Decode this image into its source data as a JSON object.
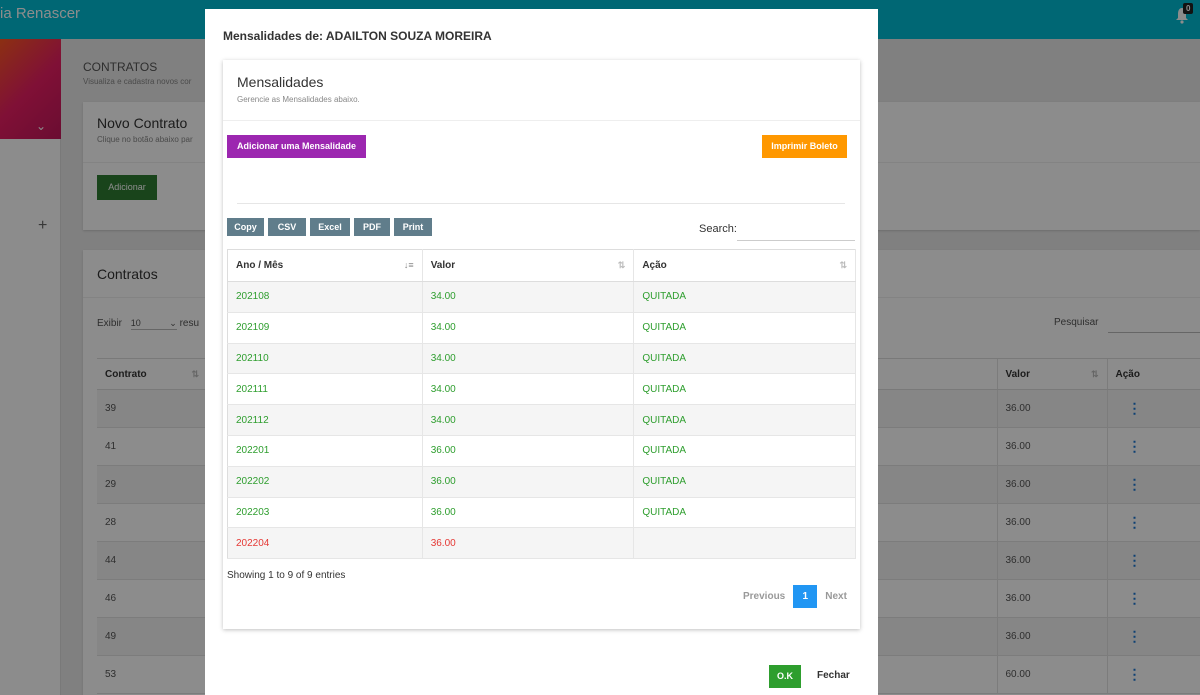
{
  "app": {
    "brand": "ia Renascer",
    "notification_count": "0"
  },
  "page": {
    "title": "CONTRATOS",
    "subtitle": "Visualiza e cadastra novos cor"
  },
  "novo_contrato": {
    "title": "Novo Contrato",
    "subtitle": "Clique no botão abaixo par",
    "button": "Adicionar"
  },
  "contratos": {
    "title": "Contratos",
    "exibir_label": "Exibir",
    "exibir_value": "10",
    "exibir_suffix": "resu",
    "pesquisar_label": "Pesquisar",
    "columns": {
      "contrato": "Contrato",
      "valor": "Valor",
      "acao": "Ação"
    },
    "rows": [
      {
        "contrato": "39",
        "valor": "36.00"
      },
      {
        "contrato": "41",
        "valor": "36.00"
      },
      {
        "contrato": "29",
        "valor": "36.00"
      },
      {
        "contrato": "28",
        "valor": "36.00"
      },
      {
        "contrato": "44",
        "valor": "36.00"
      },
      {
        "contrato": "46",
        "valor": "36.00"
      },
      {
        "contrato": "49",
        "valor": "36.00"
      },
      {
        "contrato": "53",
        "valor": "60.00"
      }
    ]
  },
  "modal": {
    "title": "Mensalidades de: ADAILTON SOUZA MOREIRA",
    "card_title": "Mensalidades",
    "card_subtitle": "Gerencie as Mensalidades abaixo.",
    "add_button": "Adicionar uma Mensalidade",
    "print_button": "Imprimir Boleto",
    "export_buttons": [
      "Copy",
      "CSV",
      "Excel",
      "PDF",
      "Print"
    ],
    "search_label": "Search:",
    "search_value": "",
    "columns": {
      "ano_mes": "Ano / Mês",
      "valor": "Valor",
      "acao": "Ação"
    },
    "rows": [
      {
        "ano_mes": "202108",
        "valor": "34.00",
        "acao": "QUITADA",
        "status": "paid"
      },
      {
        "ano_mes": "202109",
        "valor": "34.00",
        "acao": "QUITADA",
        "status": "paid"
      },
      {
        "ano_mes": "202110",
        "valor": "34.00",
        "acao": "QUITADA",
        "status": "paid"
      },
      {
        "ano_mes": "202111",
        "valor": "34.00",
        "acao": "QUITADA",
        "status": "paid"
      },
      {
        "ano_mes": "202112",
        "valor": "34.00",
        "acao": "QUITADA",
        "status": "paid"
      },
      {
        "ano_mes": "202201",
        "valor": "36.00",
        "acao": "QUITADA",
        "status": "paid"
      },
      {
        "ano_mes": "202202",
        "valor": "36.00",
        "acao": "QUITADA",
        "status": "paid"
      },
      {
        "ano_mes": "202203",
        "valor": "36.00",
        "acao": "QUITADA",
        "status": "paid"
      },
      {
        "ano_mes": "202204",
        "valor": "36.00",
        "acao": "",
        "status": "open"
      }
    ],
    "info": "Showing 1 to 9 of 9 entries",
    "pagination": {
      "previous": "Previous",
      "current": "1",
      "next": "Next"
    },
    "ok_button": "O.K",
    "close_button": "Fechar"
  },
  "colors": {
    "topbar": "#00bcd4",
    "purple": "#9c27b0",
    "orange": "#ff9800",
    "green": "#2e9e2e",
    "red": "#e53935",
    "blue": "#2196f3",
    "slate": "#607d8b"
  }
}
